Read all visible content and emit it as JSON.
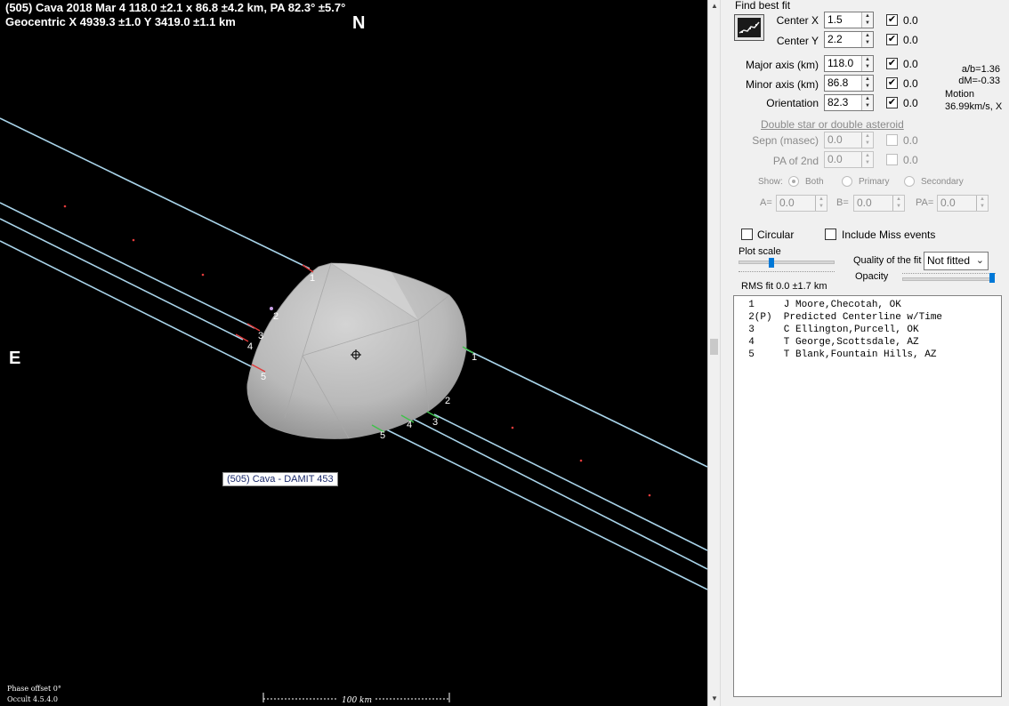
{
  "plot": {
    "title_line1": "(505) Cava  2018 Mar 4   118.0 ±2.1 x 86.8 ±4.2 km, PA 82.3° ±5.7°",
    "title_line2": "Geocentric  X  4939.3 ±1.0  Y 3419.0 ±1.1 km",
    "north_label": "N",
    "east_label": "E",
    "model_label": "(505) Cava - DAMIT 453",
    "phase_offset": "Phase offset 0°",
    "version": "Occult 4.5.4.0",
    "scale_label": "100 km",
    "chord_numbers_left": [
      "1",
      "2",
      "3",
      "4",
      "5"
    ],
    "chord_numbers_right": [
      "1",
      "2",
      "3",
      "4",
      "5"
    ],
    "colors": {
      "background": "#000000",
      "chord_line": "#a9d4ea",
      "disappearance_marker": "#e23b3b",
      "reappearance_marker": "#3fc24a",
      "asteroid_shape": "#bfbfbf"
    }
  },
  "panel": {
    "find_best_fit_label": "Find best fit",
    "find_best_fit_icon": "fit-chart-icon",
    "fit_params": [
      {
        "key": "center_x",
        "label": "Center X",
        "value": "1.5",
        "checked": true,
        "uncertainty": "0.0"
      },
      {
        "key": "center_y",
        "label": "Center Y",
        "value": "2.2",
        "checked": true,
        "uncertainty": "0.0"
      },
      {
        "key": "major_axis",
        "label": "Major axis (km)",
        "value": "118.0",
        "checked": true,
        "uncertainty": "0.0"
      },
      {
        "key": "minor_axis",
        "label": "Minor axis (km)",
        "value": "86.8",
        "checked": true,
        "uncertainty": "0.0"
      },
      {
        "key": "orientation",
        "label": "Orientation",
        "value": "82.3",
        "checked": true,
        "uncertainty": "0.0"
      }
    ],
    "ratio_ab": "a/b=1.36",
    "dm": "dM=-0.33",
    "motion_label": "Motion",
    "motion_value": "36.99km/s, X",
    "double_star_link": "Double star  or  double asteroid",
    "sepn_label": "Sepn (masec)",
    "sepn_value": "0.0",
    "sepn_uncertainty": "0.0",
    "pa2nd_label": "PA of 2nd",
    "pa2nd_value": "0.0",
    "pa2nd_uncertainty": "0.0",
    "show_label": "Show:",
    "show_options": [
      "Both",
      "Primary",
      "Secondary"
    ],
    "show_selected": "Both",
    "a_label": "A=",
    "a_value": "0.0",
    "b_label": "B=",
    "b_value": "0.0",
    "pa_label": "PA=",
    "pa_value": "0.0",
    "circular_label": "Circular",
    "circular_checked": false,
    "include_miss_label": "Include Miss events",
    "include_miss_checked": false,
    "plot_scale_label": "Plot scale",
    "plot_scale_fraction": 0.33,
    "quality_label": "Quality of the fit",
    "quality_value": "Not fitted",
    "opacity_label": "Opacity",
    "opacity_fraction": 1.0,
    "rms_fit": "RMS fit  0.0 ±1.7 km",
    "observers": [
      "  1     J Moore,Checotah, OK",
      "  2(P)  Predicted Centerline w/Time",
      "  3     C Ellington,Purcell, OK",
      "  4     T George,Scottsdale, AZ",
      "  5     T Blank,Fountain Hills, AZ"
    ]
  }
}
